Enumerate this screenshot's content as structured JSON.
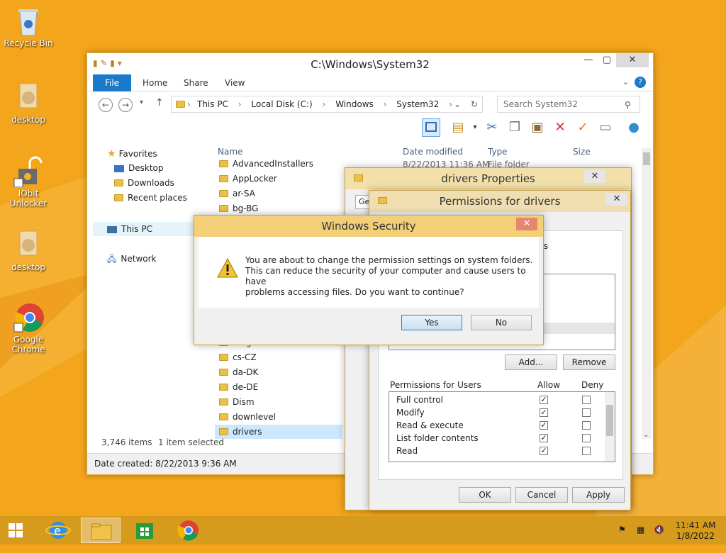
{
  "desktop": {
    "icons": [
      {
        "label": "Recycle Bin"
      },
      {
        "label": "desktop"
      },
      {
        "label": "IObit Unlocker"
      },
      {
        "label": "desktop"
      },
      {
        "label": "Google Chrome"
      }
    ]
  },
  "explorer": {
    "title": "C:\\Windows\\System32",
    "tabs": [
      "File",
      "Home",
      "Share",
      "View"
    ],
    "breadcrumb": [
      "This PC",
      "Local Disk (C:)",
      "Windows",
      "System32"
    ],
    "search_placeholder": "Search System32",
    "nav": {
      "favorites": "Favorites",
      "desktop": "Desktop",
      "downloads": "Downloads",
      "recent": "Recent places",
      "thispc": "This PC",
      "network": "Network"
    },
    "columns": {
      "name": "Name",
      "date": "Date modified",
      "type": "Type",
      "size": "Size"
    },
    "first_row": {
      "date": "8/22/2013 11:36 AM",
      "type": "File folder"
    },
    "files_top": [
      "AdvancedInstallers",
      "AppLocker",
      "ar-SA",
      "bg-BG"
    ],
    "files_bottom": [
      "cs-CZ",
      "da-DK",
      "de-DE",
      "Dism",
      "downlevel",
      "drivers"
    ],
    "partial_row": "...ng",
    "status": {
      "items": "3,746 items",
      "selected": "1 item selected"
    },
    "details": "Date created: 8/22/2013 9:36 AM"
  },
  "drivers_props": {
    "title": "drivers Properties",
    "tab_general": "Ge"
  },
  "permissions": {
    "title": "Permissions for drivers",
    "partial_label": "rs",
    "add_label": "Add...",
    "remove_label": "Remove",
    "table_header": "Permissions for Users",
    "allow_label": "Allow",
    "deny_label": "Deny",
    "rows": [
      {
        "name": "Full control",
        "allow": true,
        "deny": false
      },
      {
        "name": "Modify",
        "allow": true,
        "deny": false
      },
      {
        "name": "Read & execute",
        "allow": true,
        "deny": false
      },
      {
        "name": "List folder contents",
        "allow": true,
        "deny": false
      },
      {
        "name": "Read",
        "allow": true,
        "deny": false
      }
    ],
    "ok_label": "OK",
    "cancel_label": "Cancel",
    "apply_label": "Apply"
  },
  "windows_security": {
    "title": "Windows Security",
    "message_line1": "You are about to change the permission settings on system folders.",
    "message_line2": "This can reduce the security of your computer and cause users to have",
    "message_line3": "problems accessing files. Do you want to continue?",
    "yes_label": "Yes",
    "no_label": "No"
  },
  "taskbar": {
    "time": "11:41 AM",
    "date": "1/8/2022"
  },
  "colors": {
    "desktop": "#f3a51c",
    "title_active": "#f2ce79",
    "file_tab": "#1979ca",
    "close": "#c75050"
  }
}
